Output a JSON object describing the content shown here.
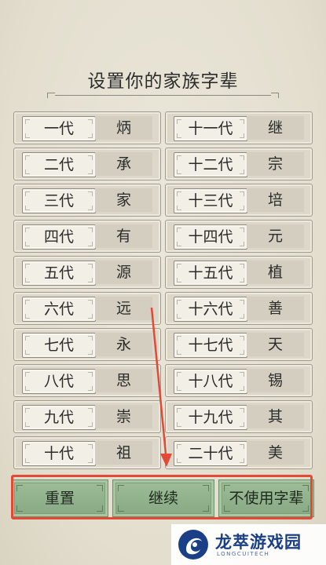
{
  "title": "设置你的家族字辈",
  "generations_left": [
    {
      "label": "一代",
      "char": "炳"
    },
    {
      "label": "二代",
      "char": "承"
    },
    {
      "label": "三代",
      "char": "家"
    },
    {
      "label": "四代",
      "char": "有"
    },
    {
      "label": "五代",
      "char": "源"
    },
    {
      "label": "六代",
      "char": "远"
    },
    {
      "label": "七代",
      "char": "永"
    },
    {
      "label": "八代",
      "char": "思"
    },
    {
      "label": "九代",
      "char": "崇"
    },
    {
      "label": "十代",
      "char": "祖"
    }
  ],
  "generations_right": [
    {
      "label": "十一代",
      "char": "继"
    },
    {
      "label": "十二代",
      "char": "宗"
    },
    {
      "label": "十三代",
      "char": "培"
    },
    {
      "label": "十四代",
      "char": "元"
    },
    {
      "label": "十五代",
      "char": "植"
    },
    {
      "label": "十六代",
      "char": "善"
    },
    {
      "label": "十七代",
      "char": "天"
    },
    {
      "label": "十八代",
      "char": "锡"
    },
    {
      "label": "十九代",
      "char": "其"
    },
    {
      "label": "二十代",
      "char": "美"
    }
  ],
  "buttons": {
    "reset": "重置",
    "continue": "继续",
    "no_generation_names": "不使用字辈"
  },
  "annotation_color": "#e24a35",
  "watermark": {
    "name": "龙萃游戏园",
    "sub": "LONGCUITECH"
  }
}
